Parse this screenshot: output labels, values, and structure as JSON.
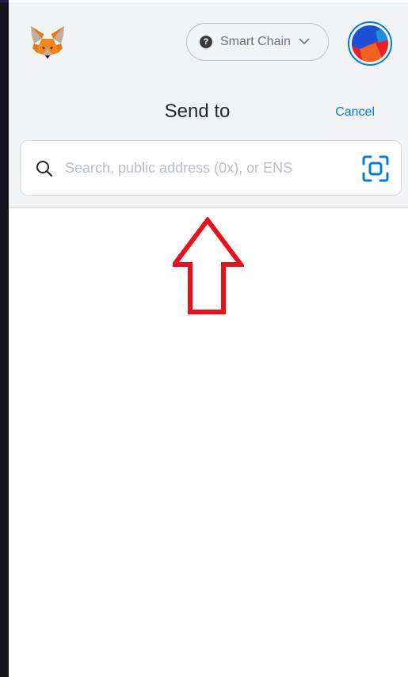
{
  "app": {
    "logo_icon": "metamask-fox-icon",
    "network": {
      "label": "Smart Chain",
      "status_icon": "question-icon"
    },
    "account_icon": "account-avatar-icon"
  },
  "send": {
    "title": "Send to",
    "cancel_label": "Cancel",
    "search": {
      "value": "",
      "placeholder": "Search, public address (0x), or ENS"
    },
    "scan_icon": "qr-scan-icon"
  },
  "colors": {
    "accent": "#037dd6",
    "annotation_arrow": "#e8111b",
    "header_bg": "#f2f3f4"
  }
}
